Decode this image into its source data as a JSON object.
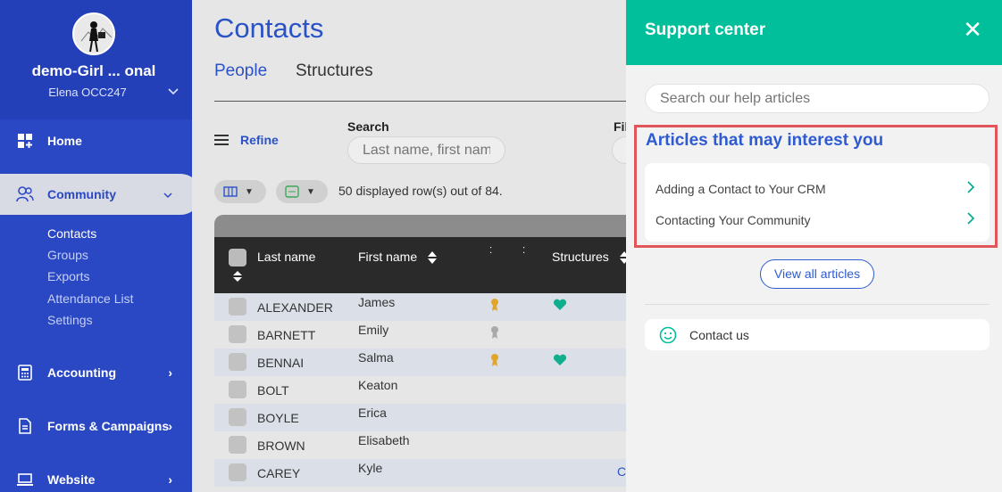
{
  "sidebar": {
    "org_name": "demo-Girl ... onal",
    "user_name": "Elena OCC247",
    "nav": [
      {
        "label": "Home",
        "icon": "dashboard-icon"
      },
      {
        "label": "Community",
        "icon": "users-icon"
      },
      {
        "label": "Accounting",
        "icon": "calculator-icon"
      },
      {
        "label": "Forms & Campaigns",
        "icon": "document-icon"
      },
      {
        "label": "Website",
        "icon": "laptop-icon"
      }
    ],
    "community_sub": [
      "Contacts",
      "Groups",
      "Exports",
      "Attendance List",
      "Settings"
    ]
  },
  "main": {
    "title": "Contacts",
    "tabs": [
      "People",
      "Structures"
    ],
    "refine_label": "Refine",
    "search_label": "Search",
    "search_placeholder": "Last name, first nam",
    "filter_label": "Fil",
    "rows_text": "50 displayed row(s) out of 84.",
    "columns": [
      "Last name",
      "First name",
      "Structures"
    ],
    "rows": [
      {
        "last": "ALEXANDER",
        "first": "James"
      },
      {
        "last": "BARNETT",
        "first": "Emily"
      },
      {
        "last": "BENNAI",
        "first": "Salma"
      },
      {
        "last": "BOLT",
        "first": "Keaton"
      },
      {
        "last": "BOYLE",
        "first": "Erica"
      },
      {
        "last": "BROWN",
        "first": "Elisabeth"
      },
      {
        "last": "CAREY",
        "first": "Kyle"
      }
    ],
    "cut_text": "C"
  },
  "support": {
    "title": "Support center",
    "close": "✕",
    "search_placeholder": "Search our help articles",
    "articles_title": "Articles that may interest you",
    "articles": [
      "Adding a Contact to Your CRM",
      "Contacting Your Community"
    ],
    "view_all": "View all articles",
    "contact_us": "Contact us"
  },
  "colors": {
    "sidebar": "#2a48c4",
    "accent_green": "#00bf9a",
    "highlight_red": "#e0565b",
    "link_blue": "#2e5bd1"
  }
}
